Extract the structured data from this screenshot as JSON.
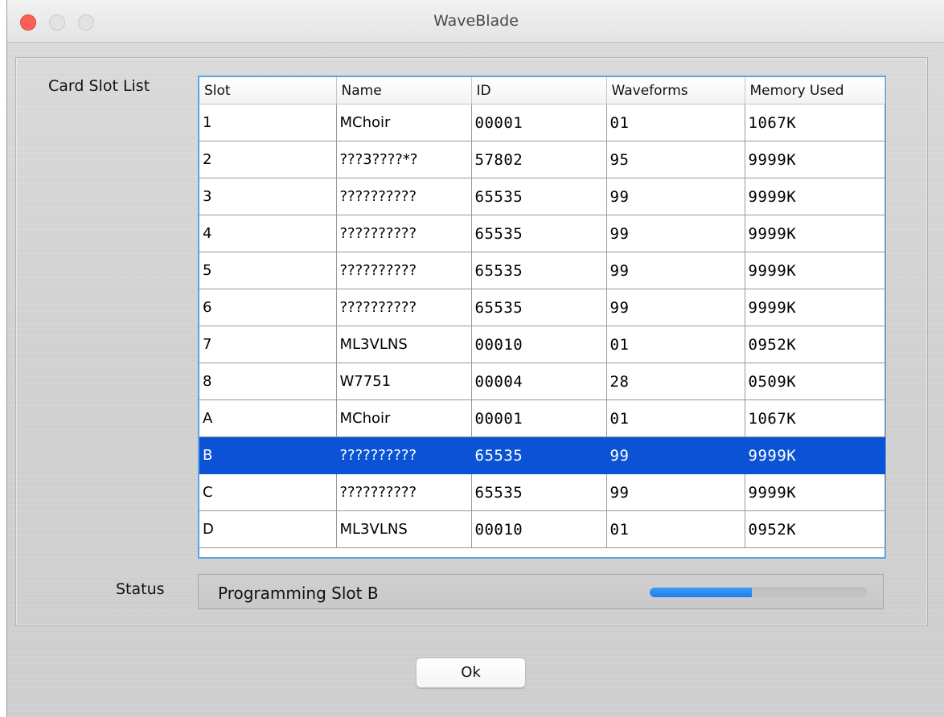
{
  "window": {
    "title": "WaveBlade"
  },
  "labels": {
    "slot_list": "Card Slot List",
    "status": "Status"
  },
  "table": {
    "columns": [
      "Slot",
      "Name",
      "ID",
      "Waveforms",
      "Memory Used"
    ],
    "rows": [
      {
        "slot": "1",
        "name": "MChoir",
        "id": "00001",
        "waveforms": "01",
        "memory": "1067K"
      },
      {
        "slot": "2",
        "name": "???3????*?",
        "id": "57802",
        "waveforms": "95",
        "memory": "9999K"
      },
      {
        "slot": "3",
        "name": "??????????",
        "id": "65535",
        "waveforms": "99",
        "memory": "9999K"
      },
      {
        "slot": "4",
        "name": "??????????",
        "id": "65535",
        "waveforms": "99",
        "memory": "9999K"
      },
      {
        "slot": "5",
        "name": "??????????",
        "id": "65535",
        "waveforms": "99",
        "memory": "9999K"
      },
      {
        "slot": "6",
        "name": "??????????",
        "id": "65535",
        "waveforms": "99",
        "memory": "9999K"
      },
      {
        "slot": "7",
        "name": "ML3VLNS",
        "id": "00010",
        "waveforms": "01",
        "memory": "0952K"
      },
      {
        "slot": "8",
        "name": "W7751",
        "id": "00004",
        "waveforms": "28",
        "memory": "0509K"
      },
      {
        "slot": "A",
        "name": "MChoir",
        "id": "00001",
        "waveforms": "01",
        "memory": "1067K"
      },
      {
        "slot": "B",
        "name": "??????????",
        "id": "65535",
        "waveforms": "99",
        "memory": "9999K"
      },
      {
        "slot": "C",
        "name": "??????????",
        "id": "65535",
        "waveforms": "99",
        "memory": "9999K"
      },
      {
        "slot": "D",
        "name": "ML3VLNS",
        "id": "00010",
        "waveforms": "01",
        "memory": "0952K"
      }
    ],
    "selected_slot": "B"
  },
  "status": {
    "text": "Programming Slot B",
    "progress": 0.47
  },
  "buttons": {
    "ok": "Ok"
  },
  "colors": {
    "selection": "#0b53d4",
    "progress": "#1e7fe6",
    "close": "#fc5f57"
  }
}
